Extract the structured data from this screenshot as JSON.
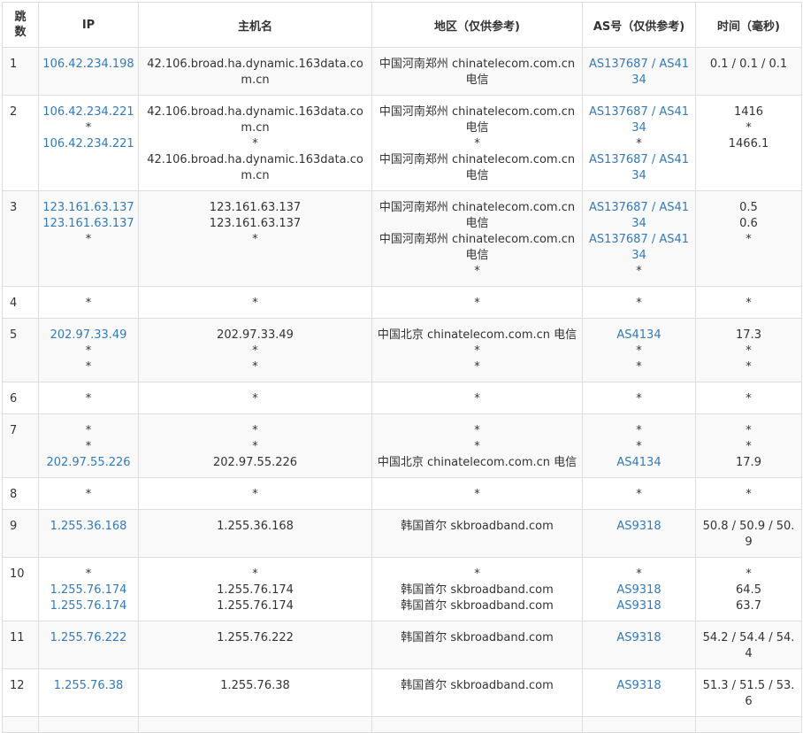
{
  "headers": {
    "hop": [
      "跳",
      "数"
    ],
    "ip": "IP",
    "host": "主机名",
    "region": "地区（仅供参考)",
    "as": "AS号（仅供参考)",
    "time": "时间（毫秒)"
  },
  "rows": [
    {
      "hop": "1",
      "ip": [
        "106.42.234.198"
      ],
      "host": [
        "42.106.broad.ha.dynamic.163data.com.cn"
      ],
      "region": [
        "中国河南郑州 chinatelecom.com.cn 电信"
      ],
      "as": [
        "AS137687 / AS4134"
      ],
      "time": [
        "0.1 / 0.1 / 0.1"
      ]
    },
    {
      "hop": "2",
      "ip": [
        "106.42.234.221",
        "*",
        "106.42.234.221"
      ],
      "host": [
        "42.106.broad.ha.dynamic.163data.com.cn",
        "*",
        "42.106.broad.ha.dynamic.163data.com.cn"
      ],
      "region": [
        "中国河南郑州 chinatelecom.com.cn 电信",
        "*",
        "中国河南郑州 chinatelecom.com.cn 电信"
      ],
      "as": [
        "AS137687 / AS4134",
        "*",
        "AS137687 / AS4134"
      ],
      "time": [
        "1416",
        "*",
        "1466.1"
      ]
    },
    {
      "hop": "3",
      "ip": [
        "123.161.63.137",
        "123.161.63.137",
        "*"
      ],
      "host": [
        "123.161.63.137",
        "123.161.63.137",
        "*"
      ],
      "region": [
        "中国河南郑州 chinatelecom.com.cn 电信",
        "中国河南郑州 chinatelecom.com.cn 电信",
        "*"
      ],
      "as": [
        "AS137687 / AS4134",
        "AS137687 / AS4134",
        "*"
      ],
      "time": [
        "0.5",
        "0.6",
        "*"
      ]
    },
    {
      "hop": "4",
      "ip": [
        "*"
      ],
      "host": [
        "*"
      ],
      "region": [
        "*"
      ],
      "as": [
        "*"
      ],
      "time": [
        "*"
      ]
    },
    {
      "hop": "5",
      "ip": [
        "202.97.33.49",
        "*",
        "*"
      ],
      "host": [
        "202.97.33.49",
        "*",
        "*"
      ],
      "region": [
        "中国北京 chinatelecom.com.cn 电信",
        "*",
        "*"
      ],
      "as": [
        "AS4134",
        "*",
        "*"
      ],
      "time": [
        "17.3",
        "*",
        "*"
      ]
    },
    {
      "hop": "6",
      "ip": [
        "*"
      ],
      "host": [
        "*"
      ],
      "region": [
        "*"
      ],
      "as": [
        "*"
      ],
      "time": [
        "*"
      ]
    },
    {
      "hop": "7",
      "ip": [
        "*",
        "*",
        "202.97.55.226"
      ],
      "host": [
        "*",
        "*",
        "202.97.55.226"
      ],
      "region": [
        "*",
        "*",
        "中国北京 chinatelecom.com.cn 电信"
      ],
      "as": [
        "*",
        "*",
        "AS4134"
      ],
      "time": [
        "*",
        "*",
        "17.9"
      ]
    },
    {
      "hop": "8",
      "ip": [
        "*"
      ],
      "host": [
        "*"
      ],
      "region": [
        "*"
      ],
      "as": [
        "*"
      ],
      "time": [
        "*"
      ]
    },
    {
      "hop": "9",
      "ip": [
        "1.255.36.168"
      ],
      "host": [
        "1.255.36.168"
      ],
      "region": [
        "韩国首尔 skbroadband.com"
      ],
      "as": [
        "AS9318"
      ],
      "time": [
        "50.8 / 50.9 / 50.9"
      ]
    },
    {
      "hop": "10",
      "ip": [
        "*",
        "1.255.76.174",
        "1.255.76.174"
      ],
      "host": [
        "*",
        "1.255.76.174",
        "1.255.76.174"
      ],
      "region": [
        "*",
        "韩国首尔 skbroadband.com",
        "韩国首尔 skbroadband.com"
      ],
      "as": [
        "*",
        "AS9318",
        "AS9318"
      ],
      "time": [
        "*",
        "64.5",
        "63.7"
      ]
    },
    {
      "hop": "11",
      "ip": [
        "1.255.76.222"
      ],
      "host": [
        "1.255.76.222"
      ],
      "region": [
        "韩国首尔 skbroadband.com"
      ],
      "as": [
        "AS9318"
      ],
      "time": [
        "54.2 / 54.4 / 54.4"
      ]
    },
    {
      "hop": "12",
      "ip": [
        "1.255.76.38"
      ],
      "host": [
        "1.255.76.38"
      ],
      "region": [
        "韩国首尔 skbroadband.com"
      ],
      "as": [
        "AS9318"
      ],
      "time": [
        "51.3 / 51.5 / 53.6"
      ]
    },
    {
      "hop": "",
      "ip": [
        ""
      ],
      "host": [
        ""
      ],
      "region": [
        ""
      ],
      "as": [
        ""
      ],
      "time": [
        ""
      ]
    }
  ]
}
